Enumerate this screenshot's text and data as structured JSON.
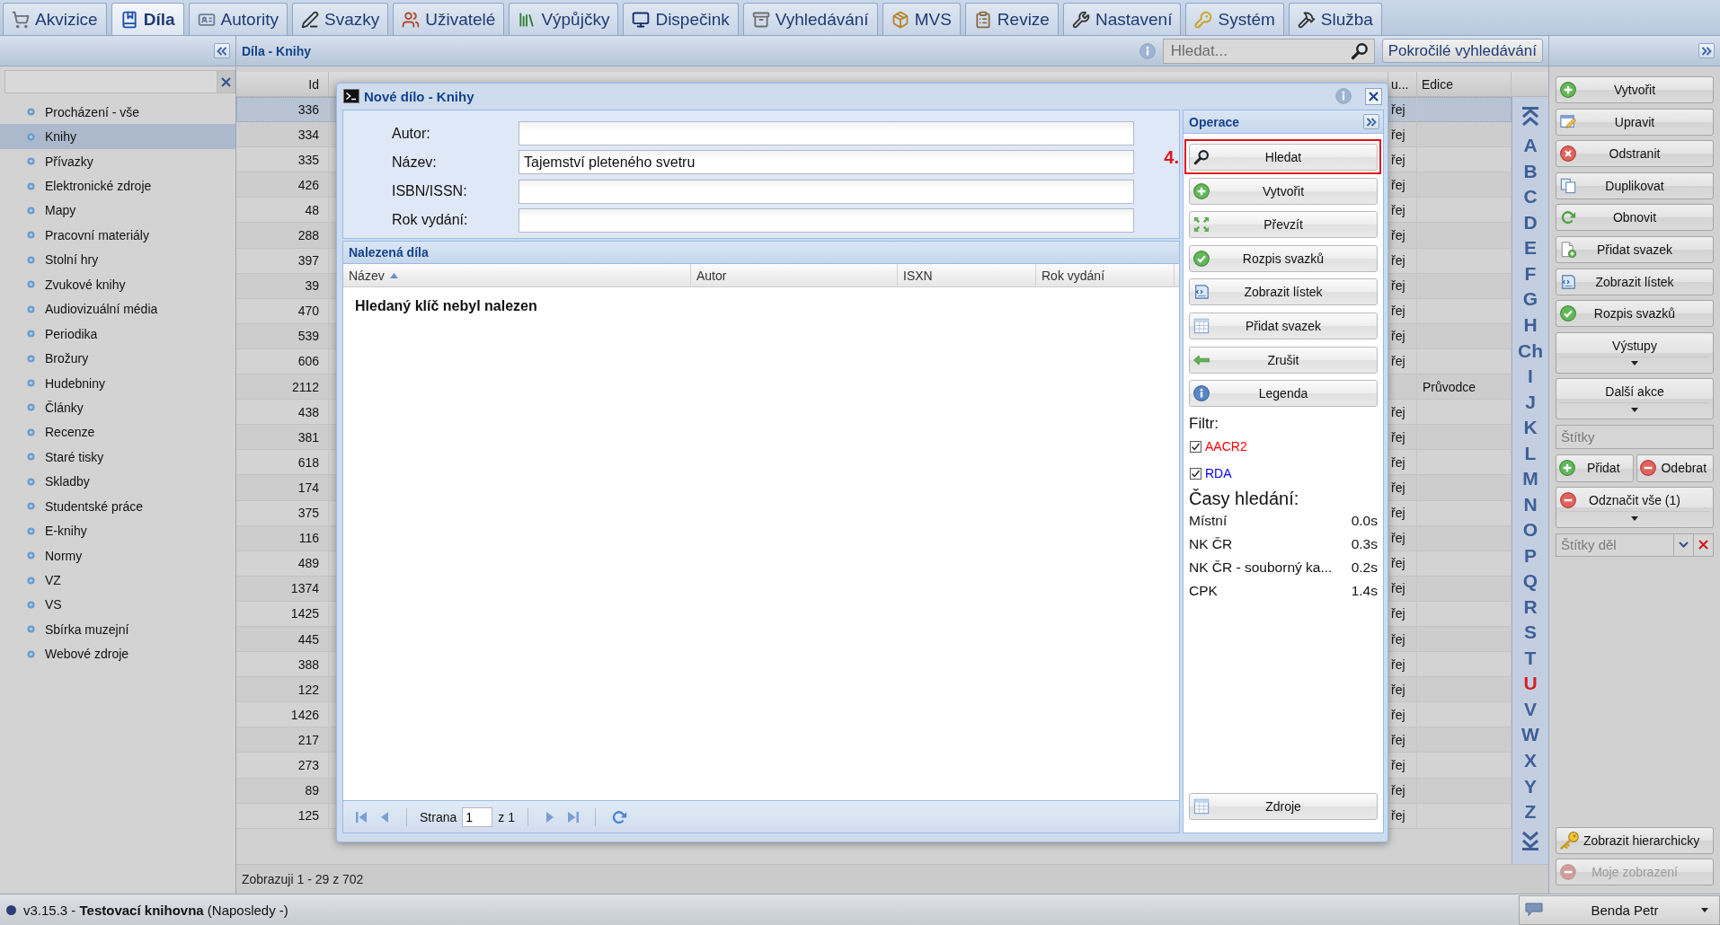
{
  "tabs": [
    {
      "label": "Akvizice",
      "selected": false
    },
    {
      "label": "Díla",
      "selected": true
    },
    {
      "label": "Autority",
      "selected": false
    },
    {
      "label": "Svazky",
      "selected": false
    },
    {
      "label": "Uživatelé",
      "selected": false
    },
    {
      "label": "Výpůjčky",
      "selected": false
    },
    {
      "label": "Dispečink",
      "selected": false
    },
    {
      "label": "Vyhledávání",
      "selected": false
    },
    {
      "label": "MVS",
      "selected": false
    },
    {
      "label": "Revize",
      "selected": false
    },
    {
      "label": "Nastavení",
      "selected": false
    },
    {
      "label": "Systém",
      "selected": false
    },
    {
      "label": "Služba",
      "selected": false
    }
  ],
  "sidebar": {
    "items": [
      {
        "label": "Procházení - vše",
        "selected": false
      },
      {
        "label": "Knihy",
        "selected": true
      },
      {
        "label": "Přívazky",
        "selected": false
      },
      {
        "label": "Elektronické zdroje",
        "selected": false
      },
      {
        "label": "Mapy",
        "selected": false
      },
      {
        "label": "Pracovní materiály",
        "selected": false
      },
      {
        "label": "Stolní hry",
        "selected": false
      },
      {
        "label": "Zvukové knihy",
        "selected": false
      },
      {
        "label": "Audiovizuální média",
        "selected": false
      },
      {
        "label": "Periodika",
        "selected": false
      },
      {
        "label": "Brožury",
        "selected": false
      },
      {
        "label": "Hudebniny",
        "selected": false
      },
      {
        "label": "Články",
        "selected": false
      },
      {
        "label": "Recenze",
        "selected": false
      },
      {
        "label": "Staré tisky",
        "selected": false
      },
      {
        "label": "Skladby",
        "selected": false
      },
      {
        "label": "Studentské práce",
        "selected": false
      },
      {
        "label": "E-knihy",
        "selected": false
      },
      {
        "label": "Normy",
        "selected": false
      },
      {
        "label": "VZ",
        "selected": false
      },
      {
        "label": "VS",
        "selected": false
      },
      {
        "label": "Sbírka muzejní",
        "selected": false
      },
      {
        "label": "Webové zdroje",
        "selected": false
      }
    ]
  },
  "main": {
    "title": "Díla - Knihy",
    "search": {
      "placeholder": "Hledat..."
    },
    "advanced_search_button": "Pokročilé vyhledávání",
    "table": {
      "columns": [
        "Id",
        "u...",
        "Edice"
      ],
      "rows": [
        {
          "id": "336",
          "column_2": "řej",
          "selected": true
        },
        {
          "id": "334",
          "column_2": "řej",
          "selected": false
        },
        {
          "id": "335",
          "column_2": "řej",
          "selected": false
        },
        {
          "id": "426",
          "column_2": "řej",
          "selected": false
        },
        {
          "id": "48",
          "column_2": "řej",
          "selected": false
        },
        {
          "id": "288",
          "column_2": "řej",
          "selected": false
        },
        {
          "id": "397",
          "column_2": "řej",
          "selected": false
        },
        {
          "id": "39",
          "column_2": "řej",
          "selected": false
        },
        {
          "id": "470",
          "column_2": "řej",
          "selected": false
        },
        {
          "id": "539",
          "column_2": "řej",
          "selected": false
        },
        {
          "id": "606",
          "column_2": "řej",
          "selected": false
        },
        {
          "id": "2112",
          "edice": "Průvodce",
          "selected": false
        },
        {
          "id": "438",
          "column_2": "řej",
          "selected": false
        },
        {
          "id": "381",
          "column_2": "řej",
          "selected": false
        },
        {
          "id": "618",
          "column_2": "řej",
          "selected": false
        },
        {
          "id": "174",
          "column_2": "řej",
          "selected": false
        },
        {
          "id": "375",
          "column_2": "řej",
          "selected": false
        },
        {
          "id": "116",
          "column_2": "řej",
          "selected": false
        },
        {
          "id": "489",
          "column_2": "řej",
          "selected": false
        },
        {
          "id": "1374",
          "column_2": "řej",
          "selected": false
        },
        {
          "id": "1425",
          "column_2": "řej",
          "selected": false
        },
        {
          "id": "445",
          "column_2": "řej",
          "selected": false
        },
        {
          "id": "388",
          "column_2": "řej",
          "selected": false
        },
        {
          "id": "122",
          "column_2": "řej",
          "selected": false
        },
        {
          "id": "1426",
          "column_2": "řej",
          "selected": false
        },
        {
          "id": "217",
          "column_2": "řej",
          "selected": false
        },
        {
          "id": "273",
          "column_2": "řej",
          "selected": false
        },
        {
          "id": "89",
          "column_2": "řej",
          "selected": false
        },
        {
          "id": "125",
          "column_2": "řej",
          "selected": false
        }
      ]
    },
    "paging_info": "Zobrazuji 1 - 29 z 702",
    "alphabet": [
      {
        "label": "A",
        "selected": false
      },
      {
        "label": "B",
        "selected": false
      },
      {
        "label": "C",
        "selected": false
      },
      {
        "label": "D",
        "selected": false
      },
      {
        "label": "E",
        "selected": false
      },
      {
        "label": "F",
        "selected": false
      },
      {
        "label": "G",
        "selected": false
      },
      {
        "label": "H",
        "selected": false
      },
      {
        "label": "Ch",
        "selected": false
      },
      {
        "label": "I",
        "selected": false
      },
      {
        "label": "J",
        "selected": false
      },
      {
        "label": "K",
        "selected": false
      },
      {
        "label": "L",
        "selected": false
      },
      {
        "label": "M",
        "selected": false
      },
      {
        "label": "N",
        "selected": false
      },
      {
        "label": "O",
        "selected": false
      },
      {
        "label": "P",
        "selected": false
      },
      {
        "label": "Q",
        "selected": false
      },
      {
        "label": "R",
        "selected": false
      },
      {
        "label": "S",
        "selected": false
      },
      {
        "label": "T",
        "selected": false
      },
      {
        "label": "U",
        "selected": true
      },
      {
        "label": "V",
        "selected": false
      },
      {
        "label": "W",
        "selected": false
      },
      {
        "label": "X",
        "selected": false
      },
      {
        "label": "Y",
        "selected": false
      },
      {
        "label": "Z",
        "selected": false
      }
    ]
  },
  "actions_panel": {
    "buttons": [
      "Vytvořit",
      "Upravit",
      "Odstranit",
      "Duplikovat",
      "Obnovit",
      "Přidat svazek",
      "Zobrazit lístek",
      "Rozpis svazků"
    ],
    "menus": [
      "Výstupy",
      "Další akce"
    ],
    "tags_field": {
      "placeholder": "Štítky"
    },
    "tag_buttons": [
      "Přidat",
      "Odebrat"
    ],
    "unmark_all_button": "Odznačit vše (1)",
    "tag_filter": {
      "placeholder": "Štítky děl"
    },
    "bottom_buttons": [
      {
        "label": "Zobrazit hierarchicky",
        "disabled": false
      },
      {
        "label": "Moje zobrazení",
        "disabled": true
      }
    ]
  },
  "dialog": {
    "title": "Nové dílo - Knihy",
    "form": [
      {
        "label": "Autor:"
      },
      {
        "label": "Název:",
        "value": "Tajemství pleteného svetru"
      },
      {
        "label": "ISBN/ISSN:"
      },
      {
        "label": "Rok vydání:"
      }
    ],
    "results": {
      "title": "Nalezená díla",
      "columns": [
        {
          "label": "Název",
          "sorted": true
        },
        {
          "label": "Autor",
          "sorted": false
        },
        {
          "label": "ISXN",
          "sorted": false
        },
        {
          "label": "Rok vydání",
          "sorted": false
        }
      ],
      "empty_message": "Hledaný klíč nebyl nalezen",
      "pager": {
        "page_label": "Strana",
        "page": "1",
        "of": "z 1"
      }
    },
    "operations": {
      "title": "Operace",
      "buttons": [
        {
          "label": "Hledat",
          "highlighted": true,
          "annotation": "4."
        },
        {
          "label": "Vytvořit",
          "highlighted": false
        },
        {
          "label": "Převzít",
          "highlighted": false
        },
        {
          "label": "Rozpis svazků",
          "highlighted": false
        },
        {
          "label": "Zobrazit lístek",
          "highlighted": false
        },
        {
          "label": "Přidat svazek",
          "highlighted": false
        },
        {
          "label": "Zrušit",
          "highlighted": false
        },
        {
          "label": "Legenda",
          "highlighted": false
        }
      ],
      "filter": {
        "title": "Filtr:",
        "items": [
          {
            "label": "AACR2",
            "checked": true,
            "color": "#ff0000"
          },
          {
            "label": "RDA",
            "checked": true,
            "color": "#0000ff"
          }
        ]
      },
      "times": {
        "title": "Časy hledání:",
        "rows": [
          {
            "source": "Místní",
            "time": "0.0s"
          },
          {
            "source": "NK ČR",
            "time": "0.3s"
          },
          {
            "source": "NK ČR - souborný ka...",
            "time": "0.2s"
          },
          {
            "source": "CPK",
            "time": "1.4s"
          }
        ]
      },
      "sources_button": "Zdroje"
    }
  },
  "status_bar": {
    "text": "v3.15.3 - **Testovací knihovna** (Naposledy -)",
    "user": "Benda Petr"
  }
}
